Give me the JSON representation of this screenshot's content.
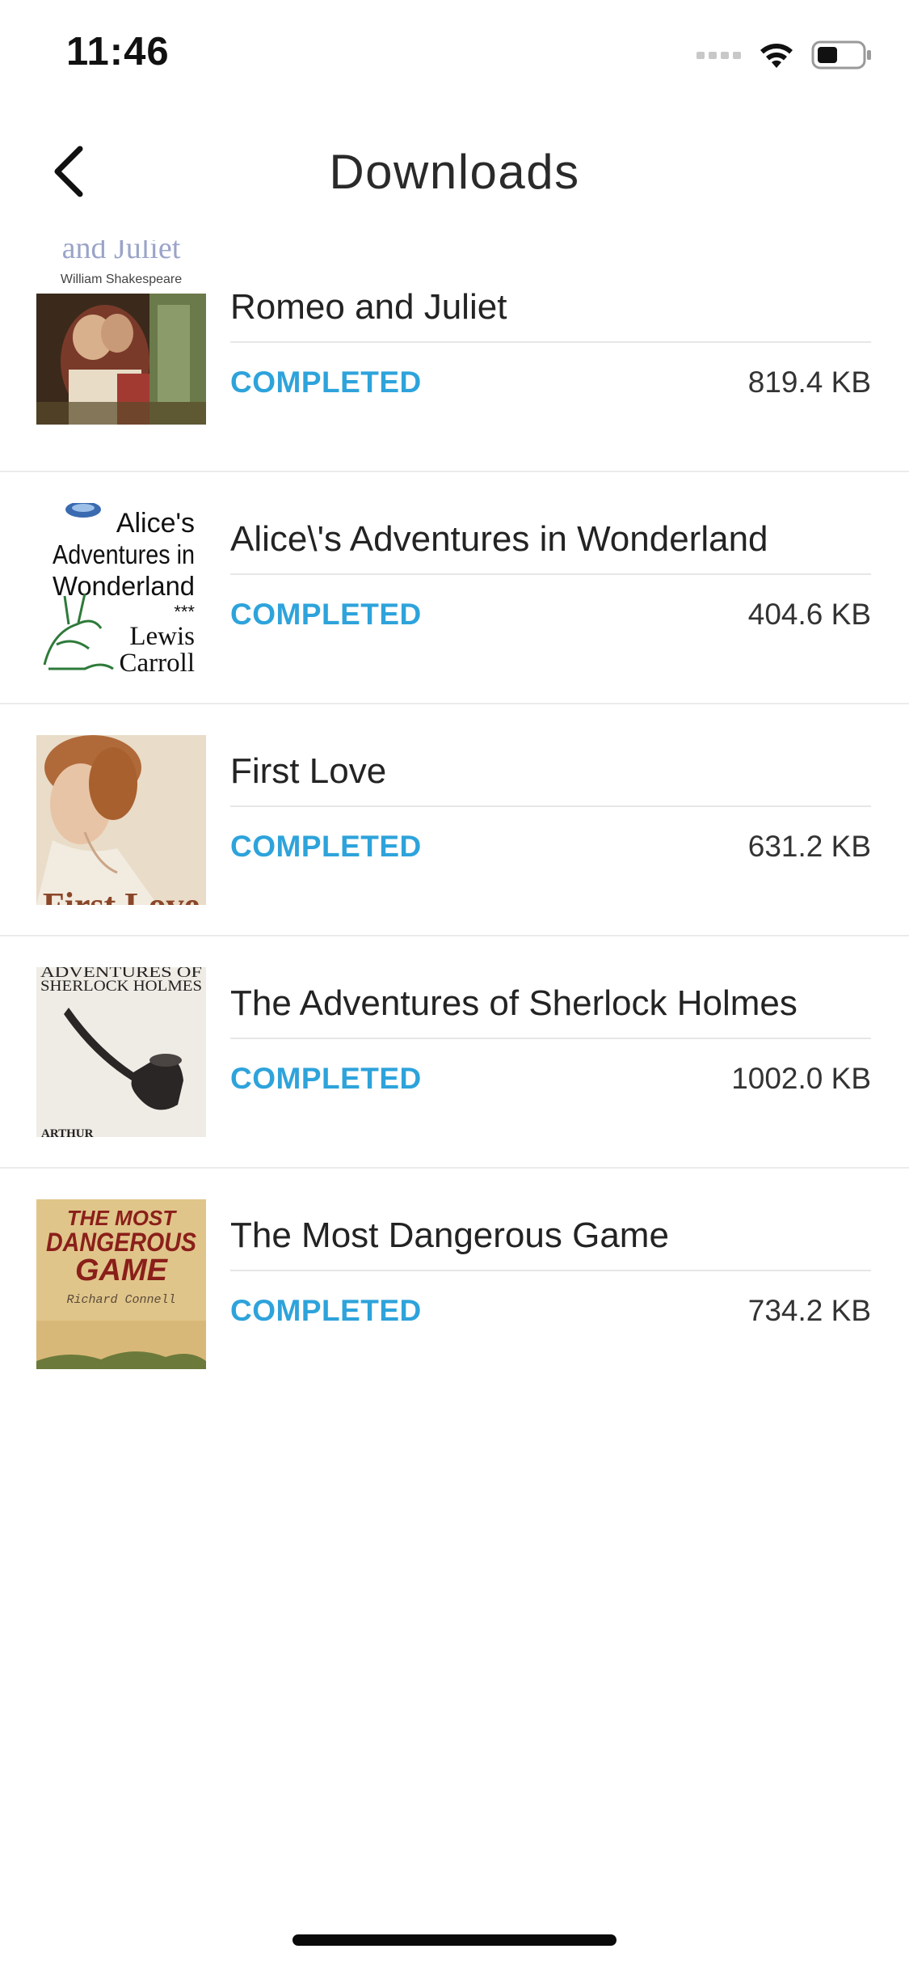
{
  "status_bar": {
    "time": "11:46"
  },
  "nav": {
    "title": "Downloads"
  },
  "colors": {
    "accent": "#2ea3db"
  },
  "downloads": [
    {
      "title": "Romeo and Juliet",
      "status": "COMPLETED",
      "size": "819.4 KB",
      "cover": {
        "top_text": "and Juliet",
        "author": "William Shakespeare"
      }
    },
    {
      "title": "Alice\\'s Adventures in Wonderland",
      "status": "COMPLETED",
      "size": "404.6 KB",
      "cover": {
        "line1": "Alice's",
        "line2": "Adventures in",
        "line3": "Wonderland",
        "stars": "***",
        "author1": "Lewis",
        "author2": "Carroll"
      }
    },
    {
      "title": "First Love",
      "status": "COMPLETED",
      "size": "631.2 KB",
      "cover": {
        "text": "First Love"
      }
    },
    {
      "title": "The Adventures of Sherlock Holmes",
      "status": "COMPLETED",
      "size": "1002.0 KB",
      "cover": {
        "line1": "ADVENTURES OF",
        "line2": "SHERLOCK HOLMES",
        "author": "ARTHUR"
      }
    },
    {
      "title": "The Most Dangerous Game",
      "status": "COMPLETED",
      "size": "734.2 KB",
      "cover": {
        "line1": "THE MOST",
        "line2": "DANGEROUS",
        "line3": "GAME",
        "author": "Richard Connell"
      }
    }
  ]
}
